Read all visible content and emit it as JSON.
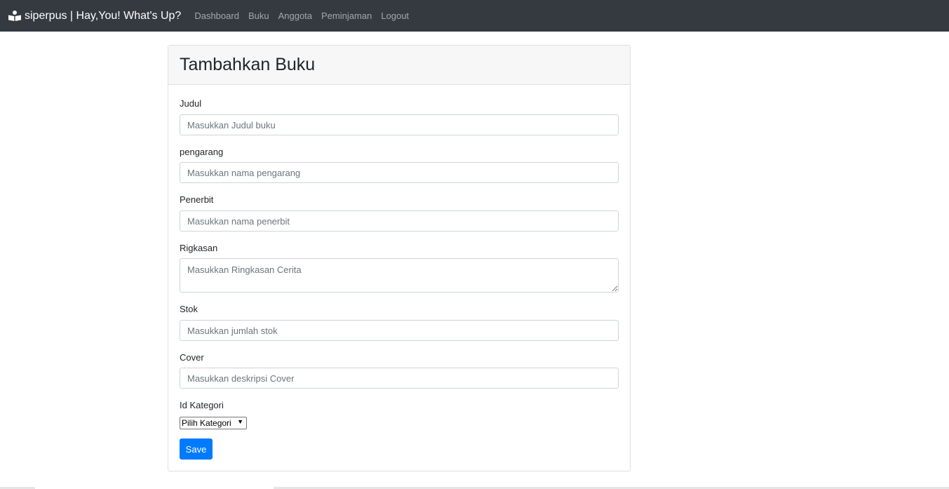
{
  "navbar": {
    "brand": "siperpus | Hay,You! What's Up?",
    "brand_icon": "book-reader-icon",
    "links": [
      "Dashboard",
      "Buku",
      "Anggota",
      "Peminjaman",
      "Logout"
    ]
  },
  "card": {
    "title": "Tambahkan Buku"
  },
  "form": {
    "judul": {
      "label": "Judul",
      "placeholder": "Masukkan Judul buku"
    },
    "pengarang": {
      "label": "pengarang",
      "placeholder": "Masukkan nama pengarang"
    },
    "penerbit": {
      "label": "Penerbit",
      "placeholder": "Masukkan nama penerbit"
    },
    "ringkasan": {
      "label": "Rigkasan",
      "placeholder": "Masukkan Ringkasan Cerita"
    },
    "stok": {
      "label": "Stok",
      "placeholder": "Masukkan jumlah stok"
    },
    "cover": {
      "label": "Cover",
      "placeholder": "Masukkan deskripsi Cover"
    },
    "kategori": {
      "label": "Id Kategori",
      "selected": "Pilih Kategori"
    },
    "save_label": "Save"
  },
  "colors": {
    "navbar_bg": "#343a40",
    "primary": "#007bff"
  }
}
